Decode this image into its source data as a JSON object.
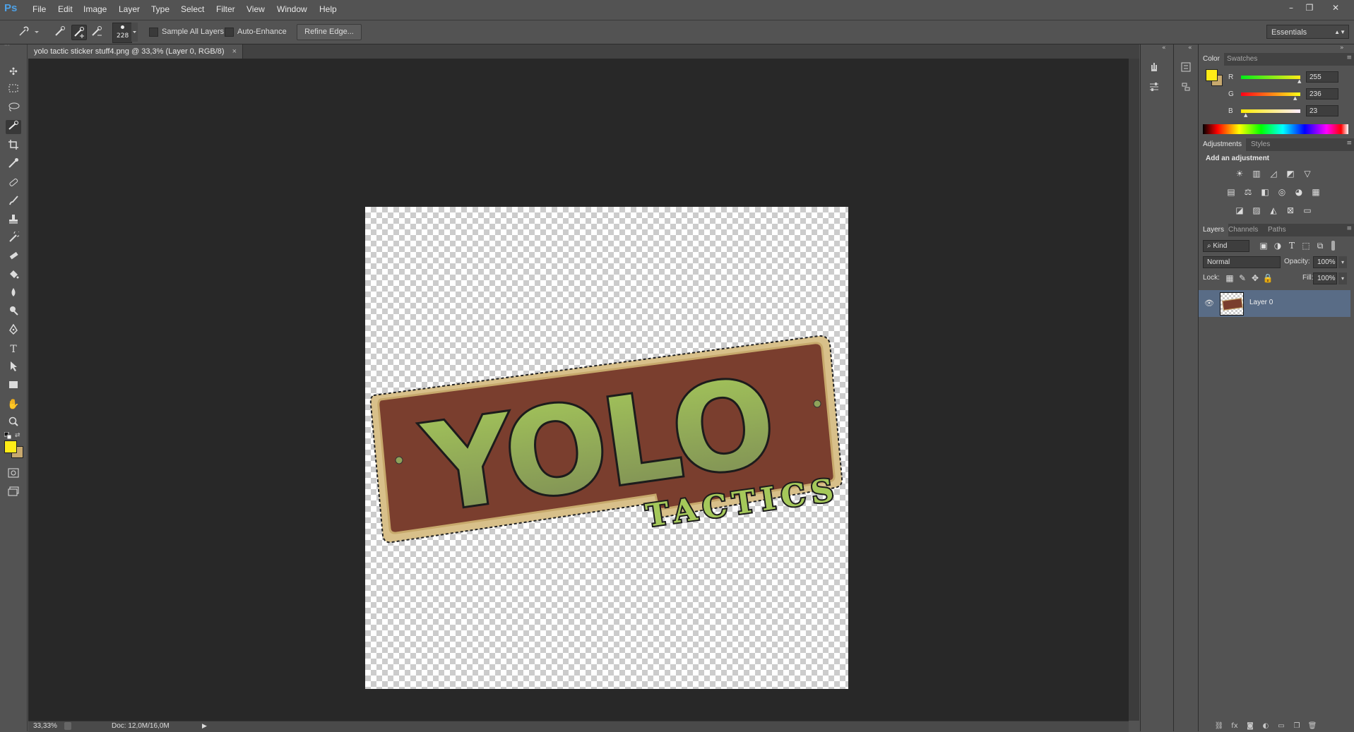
{
  "app": {
    "logo": "Ps"
  },
  "menu": [
    "File",
    "Edit",
    "Image",
    "Layer",
    "Type",
    "Select",
    "Filter",
    "View",
    "Window",
    "Help"
  ],
  "window_controls": [
    "–",
    "❐",
    "✕"
  ],
  "options_bar": {
    "brush_size": "228",
    "sample_all_layers": "Sample All Layers",
    "auto_enhance": "Auto-Enhance",
    "refine_edge": "Refine Edge...",
    "workspace": "Essentials"
  },
  "document": {
    "tab_title": "yolo tactic sticker stuff4.png @ 33,3% (Layer 0, RGB/8)",
    "tab_close": "×",
    "artwork_title": "YOLO",
    "artwork_subtitle": "TACTICS"
  },
  "status": {
    "zoom": "33,33%",
    "doc_size": "Doc: 12,0M/16,0M"
  },
  "color_panel": {
    "tabs": [
      "Color",
      "Swatches"
    ],
    "channels": [
      {
        "label": "R",
        "value": "255"
      },
      {
        "label": "G",
        "value": "236"
      },
      {
        "label": "B",
        "value": "23"
      }
    ],
    "foreground": "#ffec17",
    "background": "#c8a96e"
  },
  "adjustments_panel": {
    "tabs": [
      "Adjustments",
      "Styles"
    ],
    "heading": "Add an adjustment"
  },
  "layers_panel": {
    "tabs": [
      "Layers",
      "Channels",
      "Paths"
    ],
    "kind": "Kind",
    "blend_mode": "Normal",
    "opacity_label": "Opacity:",
    "opacity": "100%",
    "lock_label": "Lock:",
    "fill_label": "Fill:",
    "fill": "100%",
    "layers": [
      {
        "name": "Layer 0"
      }
    ]
  }
}
